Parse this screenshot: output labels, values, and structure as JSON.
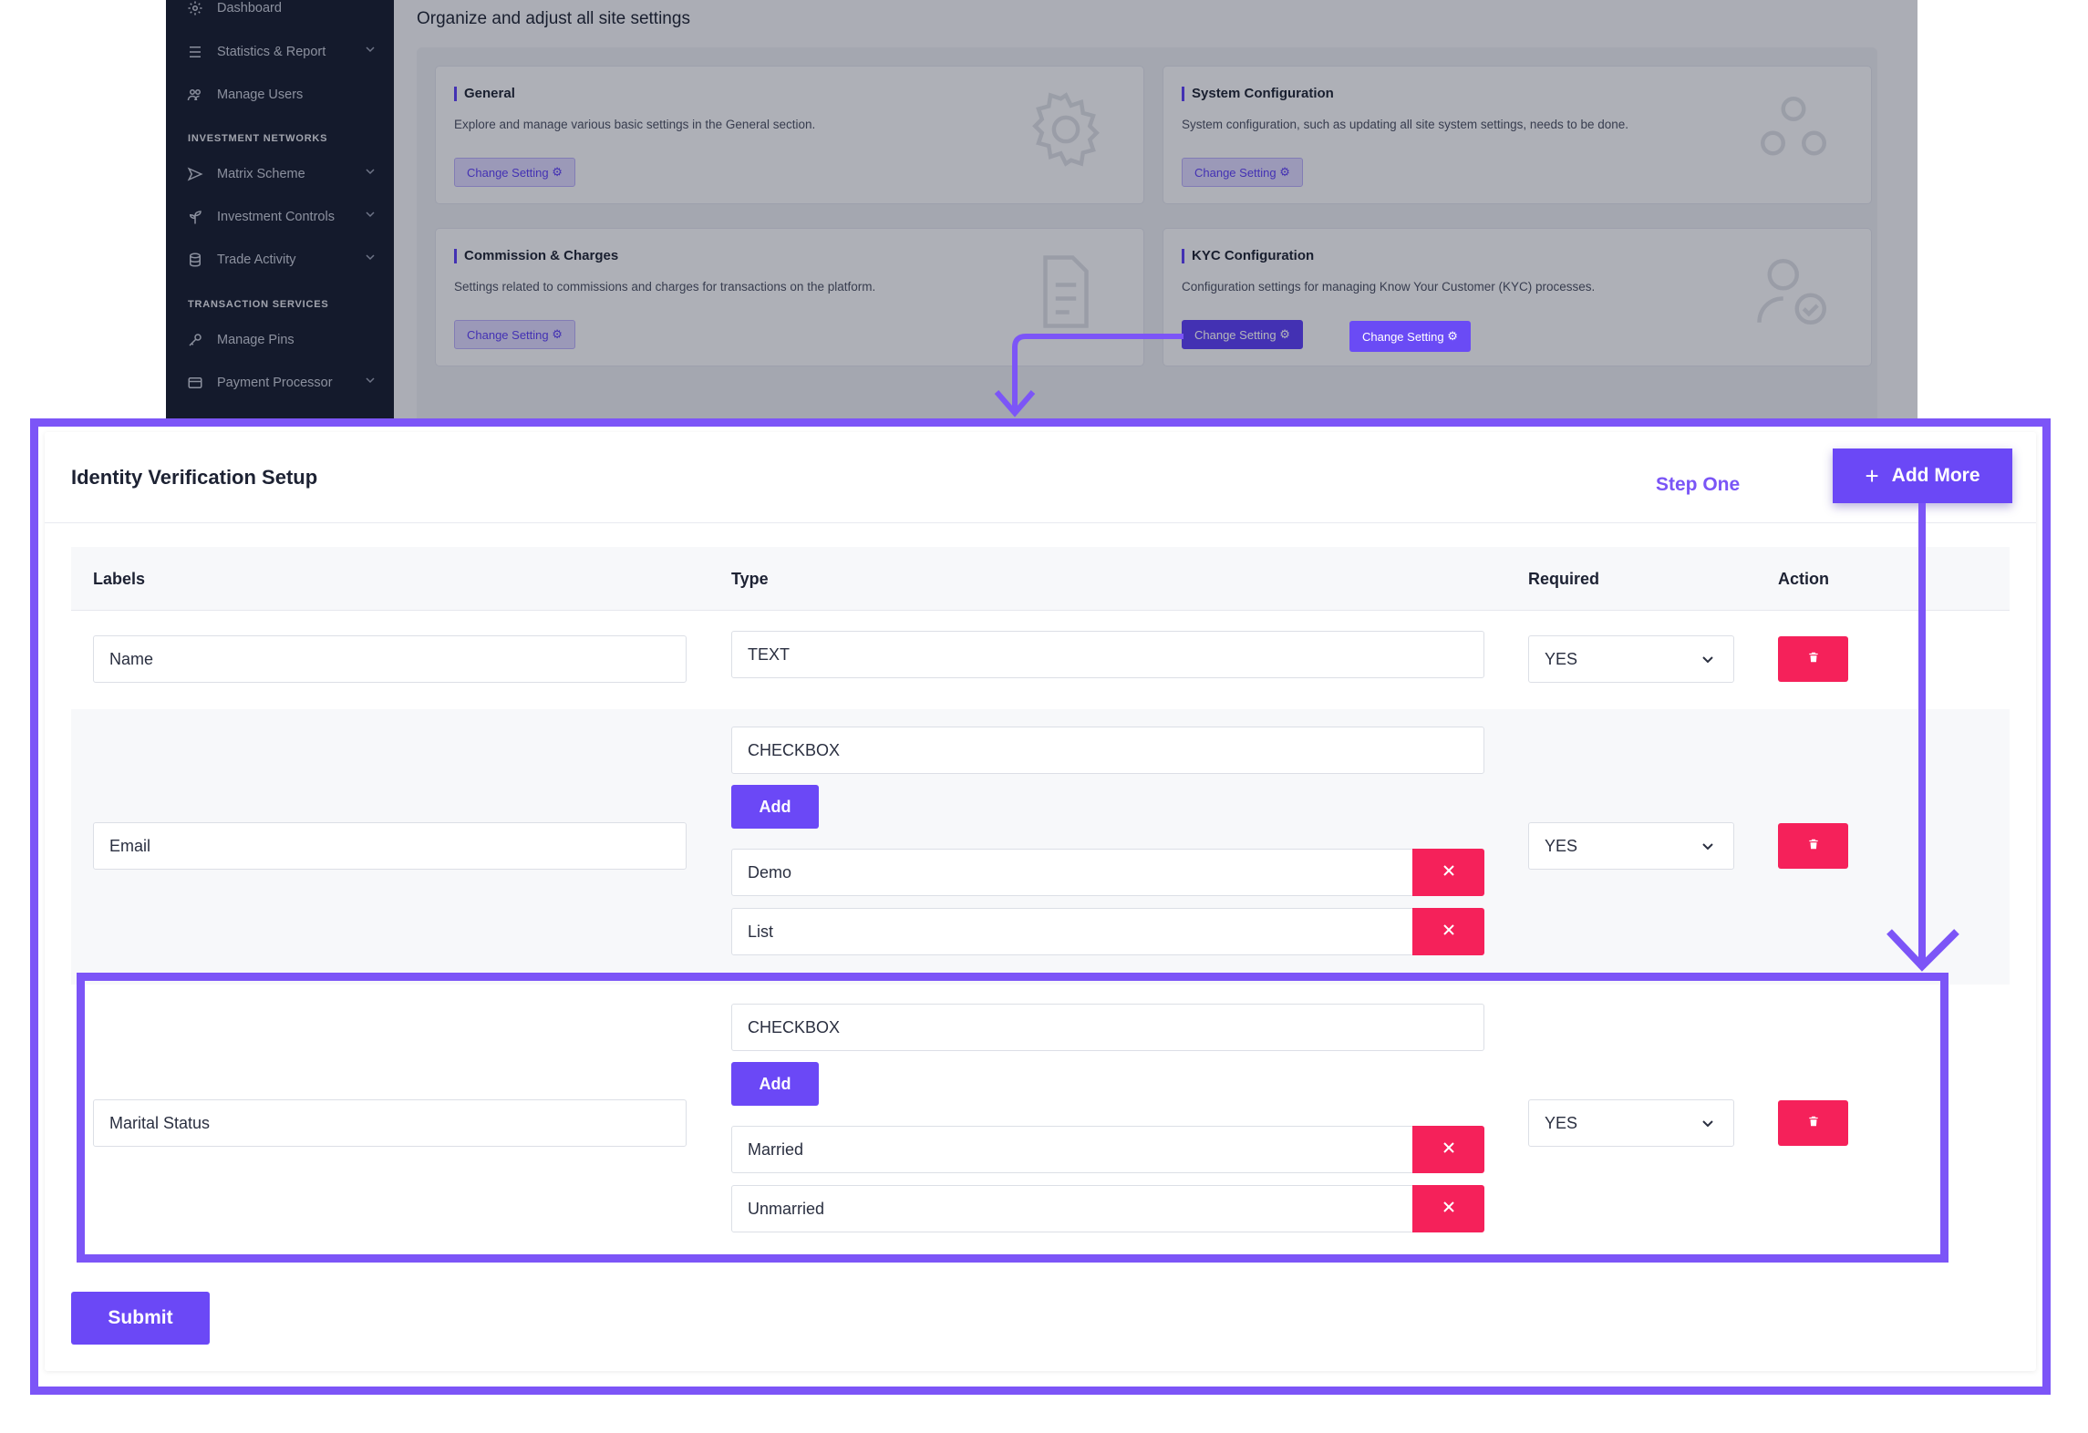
{
  "sidebar": {
    "items": [
      {
        "label": "Dashboard",
        "icon": "gear-icon"
      },
      {
        "label": "Statistics & Report",
        "icon": "list-icon"
      },
      {
        "label": "Manage Users",
        "icon": "users-icon"
      },
      {
        "label": "Matrix Scheme",
        "icon": "send-icon"
      },
      {
        "label": "Investment Controls",
        "icon": "plant-icon"
      },
      {
        "label": "Trade Activity",
        "icon": "coins-icon"
      },
      {
        "label": "Manage Pins",
        "icon": "key-icon"
      },
      {
        "label": "Payment Processor",
        "icon": "card-icon"
      }
    ],
    "headings": [
      "INVESTMENT NETWORKS",
      "TRANSACTION SERVICES"
    ]
  },
  "settings": {
    "page_title": "Organize and adjust all site settings",
    "cards": [
      {
        "title": "General",
        "description": "Explore and manage various basic settings in the General section.",
        "button": "Change Setting"
      },
      {
        "title": "System Configuration",
        "description": "System configuration, such as updating all site system settings, needs to be done.",
        "button": "Change Setting"
      },
      {
        "title": "Commission & Charges",
        "description": "Settings related to commissions and charges for transactions on the platform.",
        "button": "Change Setting"
      },
      {
        "title": "KYC Configuration",
        "description": "Configuration settings for managing Know Your Customer (KYC) processes.",
        "button": "Change Setting"
      }
    ]
  },
  "kyc": {
    "title": "Identity Verification Setup",
    "step_label": "Step One",
    "add_more_label": "Add More",
    "columns": {
      "labels": "Labels",
      "type": "Type",
      "required": "Required",
      "action": "Action"
    },
    "rows": [
      {
        "label": "Name",
        "type": "TEXT",
        "required": "YES",
        "options": []
      },
      {
        "label": "Email",
        "type": "CHECKBOX",
        "required": "YES",
        "add_label": "Add",
        "options": [
          "Demo",
          "List"
        ]
      },
      {
        "label": "Marital Status",
        "type": "CHECKBOX",
        "required": "YES",
        "add_label": "Add",
        "options": [
          "Married",
          "Unmarried"
        ]
      }
    ],
    "submit_label": "Submit"
  },
  "colors": {
    "accent": "#6b48f6",
    "highlight_frame": "#7c55f7",
    "danger": "#f5215a",
    "sidebar_bg": "#161b2e"
  }
}
